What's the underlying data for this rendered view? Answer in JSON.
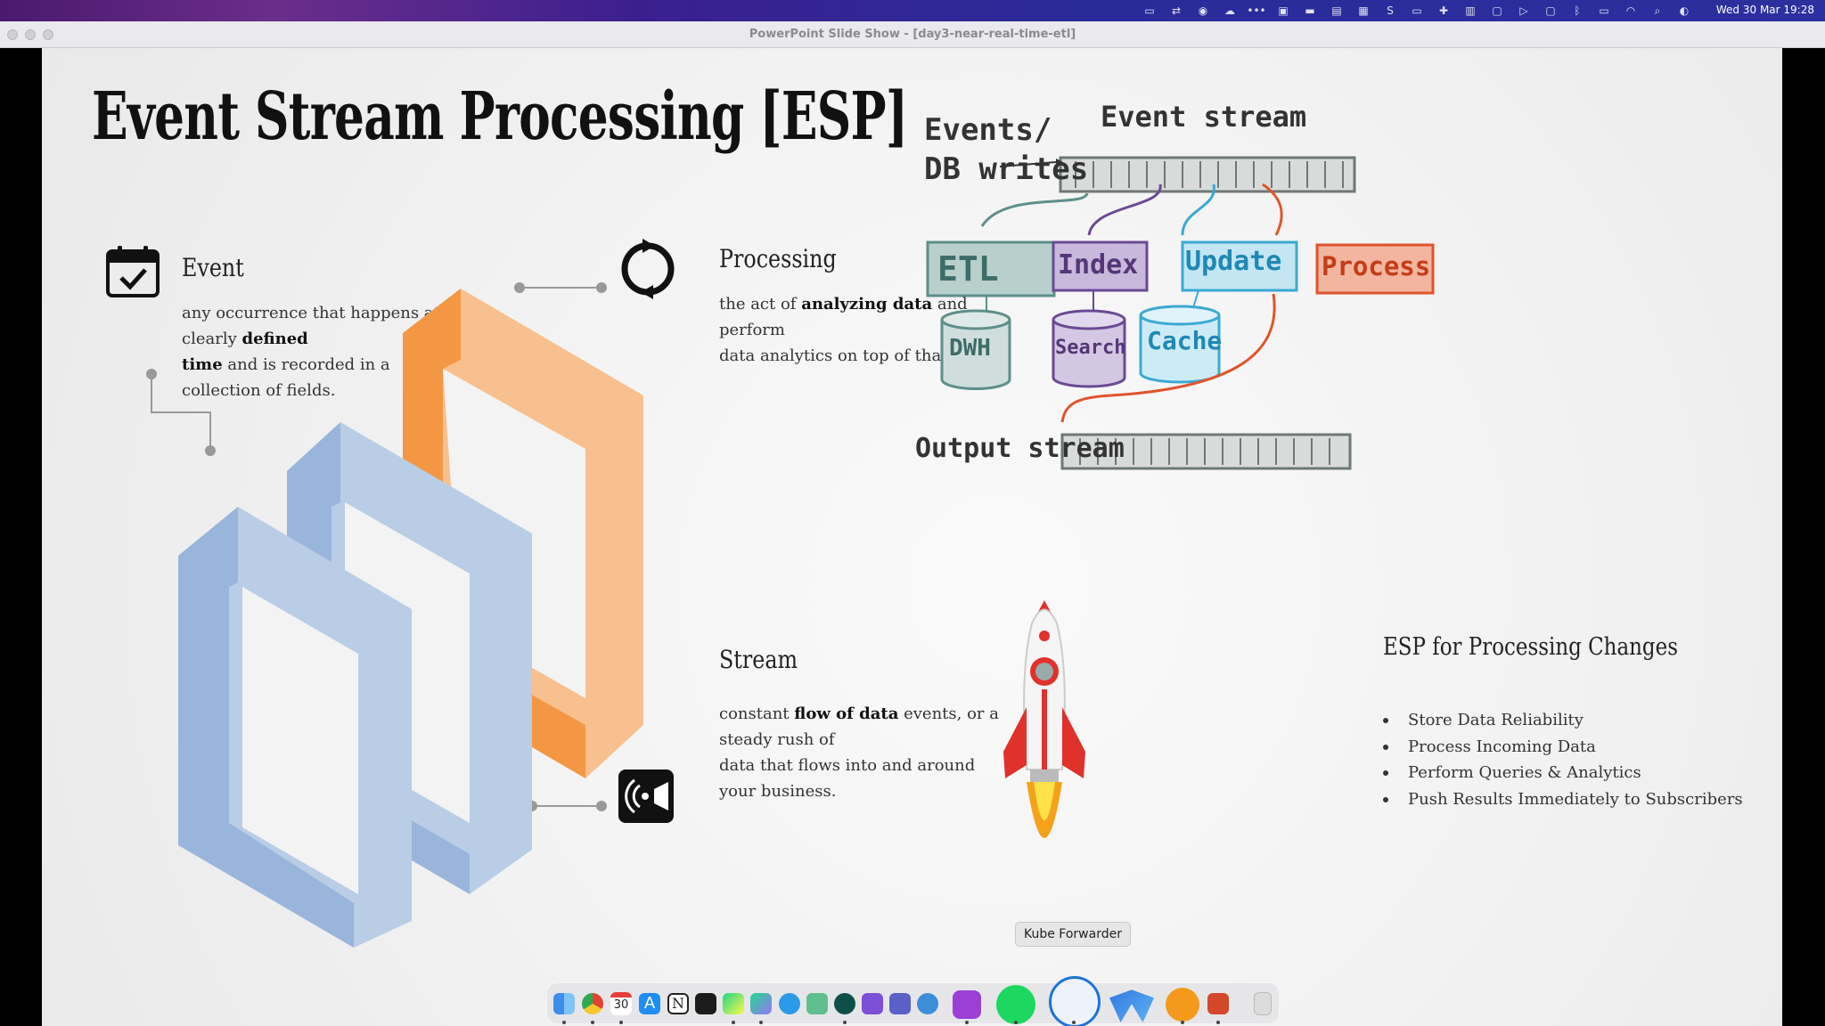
{
  "window": {
    "title": "PowerPoint Slide Show - [day3-near-real-time-etl]"
  },
  "menubar": {
    "clock": "Wed 30 Mar  19:28",
    "status_icons": [
      "window-icon",
      "network-icon",
      "grammarly-icon",
      "cloud-icon",
      "dots-icon",
      "screen-icon",
      "bar-icon",
      "pane-icon",
      "layout-icon",
      "skype-icon",
      "display-icon",
      "puzzle-icon",
      "grid-icon",
      "window2-icon",
      "play-icon",
      "window3-icon",
      "bluetooth-icon",
      "battery-icon",
      "wifi-icon",
      "search-icon",
      "control-center-icon"
    ]
  },
  "slide": {
    "title": "Event Stream Processing [ESP]",
    "event": {
      "heading": "Event",
      "desc_1": "any occurrence that happens at a clearly ",
      "desc_bold_1": "defined",
      "desc_bold_2": "time",
      "desc_2": " and is recorded in a collection of fields."
    },
    "processing": {
      "heading": "Processing",
      "desc_1": "the act of ",
      "desc_bold": "analyzing data",
      "desc_2": " and perform",
      "desc_3": "data analytics on top of that."
    },
    "stream": {
      "heading": "Stream",
      "desc_1": "constant ",
      "desc_bold": "flow of data",
      "desc_2": " events, or a steady rush of",
      "desc_3": "data that flows into and around your business."
    },
    "diagram": {
      "events_line1": "Events/",
      "events_line2": "DB writes",
      "event_stream": "Event stream",
      "boxes": [
        "ETL",
        "Index",
        "Update",
        "Process"
      ],
      "stores": [
        "DWH",
        "Search",
        "Cache"
      ],
      "output_stream": "Output stream",
      "colors": {
        "etl": "#5e8f8a",
        "index": "#6b4a93",
        "update": "#3aa9d3",
        "process": "#e0542b"
      }
    },
    "esp_changes": {
      "heading": "ESP for Processing Changes",
      "bullets": [
        "Store Data Reliability",
        "Process Incoming Data",
        "Perform Queries & Analytics",
        "Push Results Immediately to Subscribers"
      ]
    }
  },
  "dock": {
    "tooltip": "Kube Forwarder",
    "calendar_day": "30",
    "apps": [
      "finder-icon",
      "chrome-icon",
      "calendar-icon",
      "app-store-icon",
      "notion-icon",
      "terminal-icon",
      "pycharm-icon",
      "datagrip-icon",
      "messenger-icon",
      "atom-icon",
      "gitkraken-icon",
      "github-desktop-icon",
      "teams-icon",
      "network-radar-icon",
      "podcasts-icon",
      "spotify-icon",
      "kube-forwarder-icon",
      "pen-app-icon",
      "photos-app-icon",
      "powerpoint-icon",
      "trash-icon"
    ]
  }
}
